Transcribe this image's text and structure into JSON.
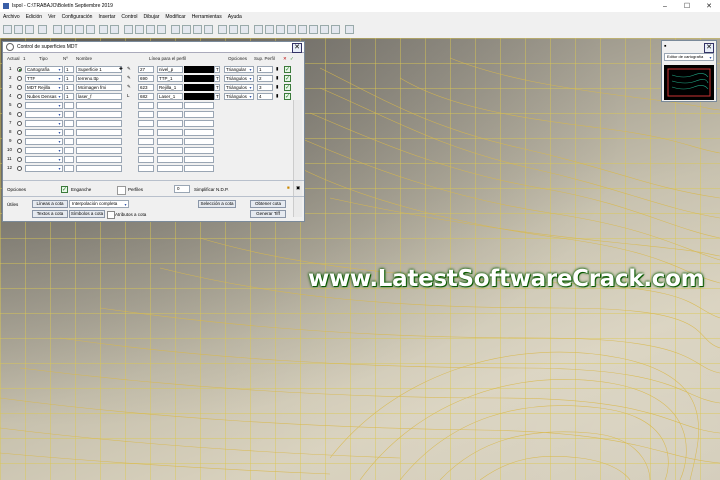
{
  "window": {
    "title": "Ispol - C:\\TRABAJO\\Boletín Septiembre 2019",
    "minimize": "–",
    "maximize": "☐",
    "close": "✕"
  },
  "menu": [
    "Archivo",
    "Edición",
    "Ver",
    "Configuración",
    "Insertar",
    "Control",
    "Dibujar",
    "Modificar",
    "Herramientas",
    "Ayuda"
  ],
  "panel": {
    "title": "Control de superficies MDT",
    "close": "✕",
    "headers": {
      "actual": "Actual",
      "one": "1",
      "tipo": "Tipo",
      "nfile": "Nº",
      "nombre": "Nombre",
      "linea": "Línea para el perfil",
      "opciones": "Opciones",
      "sup_perfil": "Sup. Perfil"
    },
    "rows": [
      {
        "num": "1",
        "tipo": "Cartografía",
        "n": "1",
        "nombre": "Superficie 1",
        "line": "27",
        "linea": "nivel_p",
        "opcion": "Triangular",
        "sup": "1"
      },
      {
        "num": "2",
        "tipo": "TTF",
        "n": "1",
        "nombre": "terreno.ttp",
        "line": "690",
        "linea": "TTP_1",
        "opcion": "Triángulos",
        "sup": "2"
      },
      {
        "num": "3",
        "tipo": "MDT Rejilla",
        "n": "1",
        "nombre": "Mcimagen fmi",
        "line": "623",
        "linea": "Rejilla_1",
        "opcion": "Triángulos",
        "sup": "3"
      },
      {
        "num": "4",
        "tipo": "Nubes Densas",
        "n": "1",
        "nombre": "laser_f",
        "line": "682",
        "linea": "Laser_1",
        "opcion": "Triángulos",
        "sup": "4"
      },
      {
        "num": "5"
      },
      {
        "num": "6"
      },
      {
        "num": "7"
      },
      {
        "num": "8"
      },
      {
        "num": "9"
      },
      {
        "num": "10"
      },
      {
        "num": "11"
      },
      {
        "num": "12"
      }
    ],
    "opciones_label": "Opciones",
    "enganche": "Enganche",
    "perfiles": "Perfiles",
    "simplificar_value": "0",
    "simplificar": "Simplificar N.D.P.",
    "utiles": "Útiles",
    "lineas_cota": "Líneas a cota",
    "interpolacion": "Interpolación completa",
    "textos_cota": "Textos a cota",
    "simbolos_cota": "Símbolos a cota",
    "atributos_cota": "Atributos a cota",
    "seleccion_cota": "Selección a cota",
    "obtener_cota": "Obtener cota",
    "generar_tiff": "Generar Tiff"
  },
  "mini": {
    "title": "Editor de cartografía"
  },
  "watermark": "www.LatestSoftwareCrack.com",
  "colors": {
    "accent": "#1a7a1a",
    "watermark_text": "#ffffff",
    "watermark_outline": "#0a5a00",
    "grid": "#dcc850"
  }
}
